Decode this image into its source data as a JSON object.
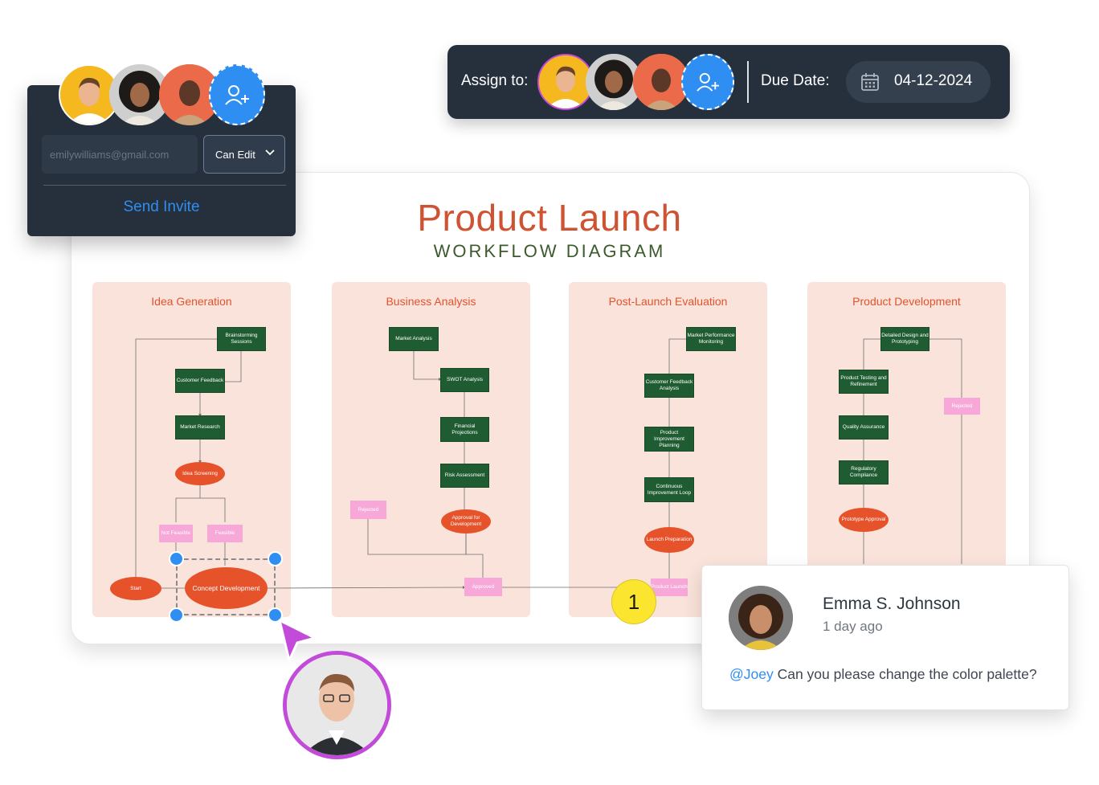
{
  "invite": {
    "email_placeholder": "emilywilliams@gmail.com",
    "permission": "Can Edit",
    "send_label": "Send Invite"
  },
  "assign": {
    "assign_label": "Assign to:",
    "due_label": "Due Date:",
    "due_date": "04-12-2024"
  },
  "diagram": {
    "title": "Product Launch",
    "subtitle": "WORKFLOW DIAGRAM",
    "lanes": [
      {
        "title": "Idea Generation"
      },
      {
        "title": "Business Analysis"
      },
      {
        "title": "Post-Launch Evaluation"
      },
      {
        "title": "Product Development"
      }
    ],
    "idea": {
      "brainstorming": "Brainstorming Sessions",
      "customer_feedback": "Customer Feedback",
      "market_research": "Market Research",
      "idea_screening": "Idea Screening",
      "not_feasible": "Not Feasible",
      "feasible": "Feasible",
      "start": "Start",
      "concept": "Concept Development"
    },
    "business": {
      "market_analysis": "Market Analysis",
      "swot": "SWOT Analysis",
      "financial": "Financial Projections",
      "risk": "Risk Assessment",
      "approval": "Approval for Development",
      "rejected": "Rejected",
      "approved": "Approved"
    },
    "post": {
      "monitoring": "Market Performance Monitoring",
      "feedback_analysis": "Customer Feedback Analysis",
      "improvement_planning": "Product Improvement Planning",
      "continuous": "Continuous Improvement Loop",
      "launch_prep": "Launch Preparation",
      "product_launch": "Product Launch"
    },
    "dev": {
      "design": "Detailed Design and Prototyping",
      "testing": "Product Testing and Refinement",
      "qa": "Quality Assurance",
      "regulatory": "Regulatory Compliance",
      "prototype_approval": "Prototype Approval",
      "rejected": "Rejected"
    }
  },
  "comment": {
    "pin_number": "1",
    "author": "Emma S. Johnson",
    "time": "1 day ago",
    "mention": "@Joey",
    "text": " Can you please change the color palette?"
  },
  "colors": {
    "panel_bg": "#26303d",
    "accent_blue": "#2e8ef2",
    "title_orange": "#cf5232",
    "lane_bg": "#fae3da",
    "node_green": "#1f5c32",
    "node_orange": "#e6532b",
    "node_pink": "#f7a8d8",
    "cursor_purple": "#c34bd9",
    "pin_yellow": "#fbe52f"
  }
}
